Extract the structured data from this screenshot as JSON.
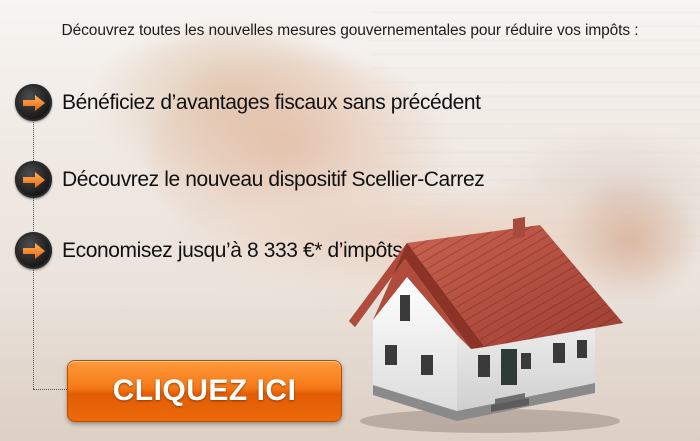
{
  "headline": "Découvrez toutes les nouvelles mesures gouvernementales pour réduire vos impôts :",
  "benefits": [
    {
      "icon": "arrow-right-icon",
      "text": "Bénéficiez d’avantages fiscaux sans précédent"
    },
    {
      "icon": "arrow-right-icon",
      "text": "Découvrez le nouveau dispositif Scellier-Carrez"
    },
    {
      "icon": "arrow-right-icon",
      "text": "Economisez jusqu’à 8 333 €* d’impôts par an"
    }
  ],
  "cta": {
    "label": "CLIQUEZ ICI"
  },
  "colors": {
    "accent": "#f57a16",
    "roof": "#b44a3a",
    "walls": "#f3f3f3",
    "text": "#111111"
  }
}
